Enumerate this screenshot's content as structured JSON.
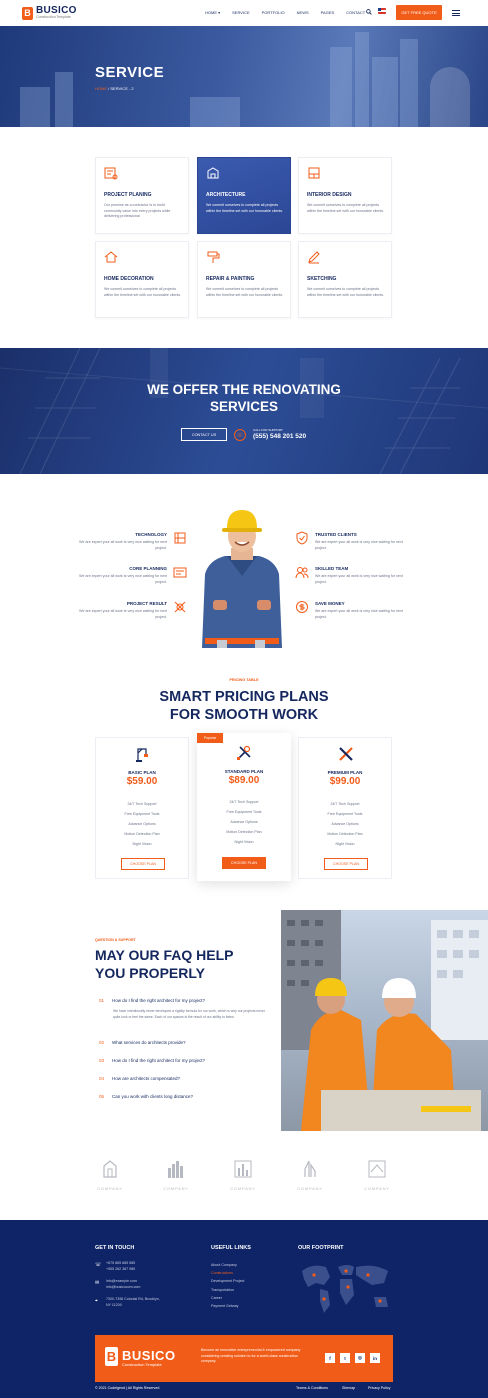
{
  "header": {
    "logo_mark": "B",
    "logo_title": "BUSICO",
    "logo_subtitle": "Construction Template",
    "nav": [
      "HOME ▾",
      "SERVICE",
      "PORTFOLIO",
      "NEWS",
      "PAGES",
      "CONTACT"
    ],
    "cta": "GET FREE QUOTE",
    "icons": [
      "search-icon",
      "flag-icon",
      "menu-icon"
    ]
  },
  "hero": {
    "title": "SERVICE",
    "crumb_home": "HOME",
    "crumb_sep": "/",
    "crumb_current": "SERVICE - 2"
  },
  "services": [
    {
      "title": "PROJECT PLANING",
      "desc": "Our promise as a contractor is to build community value into every projects while delivering professional",
      "icon": "blueprint-icon",
      "active": false
    },
    {
      "title": "ARCHITECTURE",
      "desc": "We commit ourselves to complete all projects within the timeline set with our honorable clients.",
      "icon": "architecture-icon",
      "active": true
    },
    {
      "title": "INTERIOR DESIGN",
      "desc": "We commit ourselves to complete all projects within the timeline set with our honorable clients.",
      "icon": "interior-icon",
      "active": false
    },
    {
      "title": "HOME DECORATION",
      "desc": "We commit ourselves to complete all projects within the timeline set with our honorable clients.",
      "icon": "home-decor-icon",
      "active": false
    },
    {
      "title": "REPAIR & PAINTING",
      "desc": "We commit ourselves to complete all projects within the timeline set with our honorable clients.",
      "icon": "paint-roller-icon",
      "active": false
    },
    {
      "title": "SKETCHING",
      "desc": "We commit ourselves to complete all projects within the timeline set with our honorable clients.",
      "icon": "sketch-icon",
      "active": false
    }
  ],
  "offer": {
    "line1": "WE OFFER THE RENOVATING",
    "line2": "SERVICES",
    "button": "CONTACT US",
    "call_label": "CALL FOR SUPPORT",
    "phone": "(555) 548 201 520"
  },
  "features_left": [
    {
      "title": "TECHNOLOGY",
      "desc": "We are expert your all work is very nice waiting for next project.",
      "icon": "technology-icon"
    },
    {
      "title": "CORE PLANNING",
      "desc": "We are expert your all work is very nice waiting for next project.",
      "icon": "planning-icon"
    },
    {
      "title": "PROJECT RESULT",
      "desc": "We are expert your all work is very nice waiting for next project.",
      "icon": "result-icon"
    }
  ],
  "features_right": [
    {
      "title": "TRUSTED CLIENTS",
      "desc": "We are expert your all work is very nice waiting for next project.",
      "icon": "shield-check-icon"
    },
    {
      "title": "SKILLED TEAM",
      "desc": "We are expert your all work is very nice waiting for next project.",
      "icon": "team-icon"
    },
    {
      "title": "SAVE MONEY",
      "desc": "We are expert your all work is very nice waiting for next project.",
      "icon": "money-icon"
    }
  ],
  "pricing": {
    "kicker": "PRICING TABLE",
    "title_line1": "SMART PRICING PLANS",
    "title_line2": "FOR SMOOTH WORK",
    "popular_badge": "Popular",
    "plans": [
      {
        "name": "BASIC PLAN",
        "price": "$59.00",
        "features": [
          "24/7 Tech Support",
          "Free Equipment Tools",
          "Advance Options",
          "Motion Detection Plan",
          "Night Vision"
        ],
        "button": "CHOOSE PLAN",
        "icon": "crane-icon"
      },
      {
        "name": "STANDARD PLAN",
        "price": "$89.00",
        "features": [
          "24/7 Tech Support",
          "Free Equipment Tools",
          "Advance Options",
          "Motion Detection Plan",
          "Night Vision"
        ],
        "button": "CHOOSE PLAN",
        "icon": "tools-icon"
      },
      {
        "name": "PREMIUM PLAN",
        "price": "$99.00",
        "features": [
          "24/7 Tech Support",
          "Free Equipment Tools",
          "Advance Options",
          "Motion Detection Plan",
          "Night Vision"
        ],
        "button": "CHOOSE PLAN",
        "icon": "ruler-pencil-icon"
      }
    ]
  },
  "faq": {
    "kicker": "QUESTION & SUPPORT",
    "title_line1": "MAY OUR FAQ HELP",
    "title_line2": "YOU PROPERLY",
    "items": [
      {
        "num": "01",
        "q": "How do I find the right architect for my project?"
      },
      {
        "num": "02",
        "q": "What services do architects provide?"
      },
      {
        "num": "03",
        "q": "How do I find the right architect for my project?"
      },
      {
        "num": "04",
        "q": "How are architects compensated?"
      },
      {
        "num": "05",
        "q": "Can you work with clients long distance?"
      }
    ],
    "answer": "We have intentionally never developed a rigidity formula for our work, which is why our projects never quite look or feel the same. Each of our spaces is the result of our ability to listen."
  },
  "companies": [
    "COMPANY",
    "COMPANY",
    "COMPANY",
    "COMPANY",
    "COMPANY"
  ],
  "footer": {
    "touch_title": "GET IN TOUCH",
    "phone1": "+675 865 685 585",
    "phone2": "+555 262 387 985",
    "email1": "info@example.com",
    "email2": "info@busicocom.com",
    "address1": "7300-7398 Colonial Rd, Brooklyn,",
    "address2": "NY 11209",
    "links_title": "USEFUL LINKS",
    "links": [
      "About Company",
      "Constructions",
      "Development Project",
      "Transportation",
      "Career",
      "Payment Getway"
    ],
    "footprint_title": "OUR FOOTPRINT",
    "brand_mark": "B",
    "brand_title": "BUSICO",
    "brand_sub": "Construction Template",
    "brand_desc": "Become an innovative entrepreneurial & empowered company considering creating solution to for a world-class construction company.",
    "social": [
      "f",
      "t",
      "◎",
      "in"
    ],
    "copyright": "© 2021 Codeigend  |  All Rights Reserved",
    "bottom_links": [
      "Teams & Conditions",
      "Sitemap",
      "Privacy Policy"
    ]
  },
  "colors": {
    "accent": "#f25c19",
    "navy": "#14275e",
    "footer": "#0f2467"
  }
}
